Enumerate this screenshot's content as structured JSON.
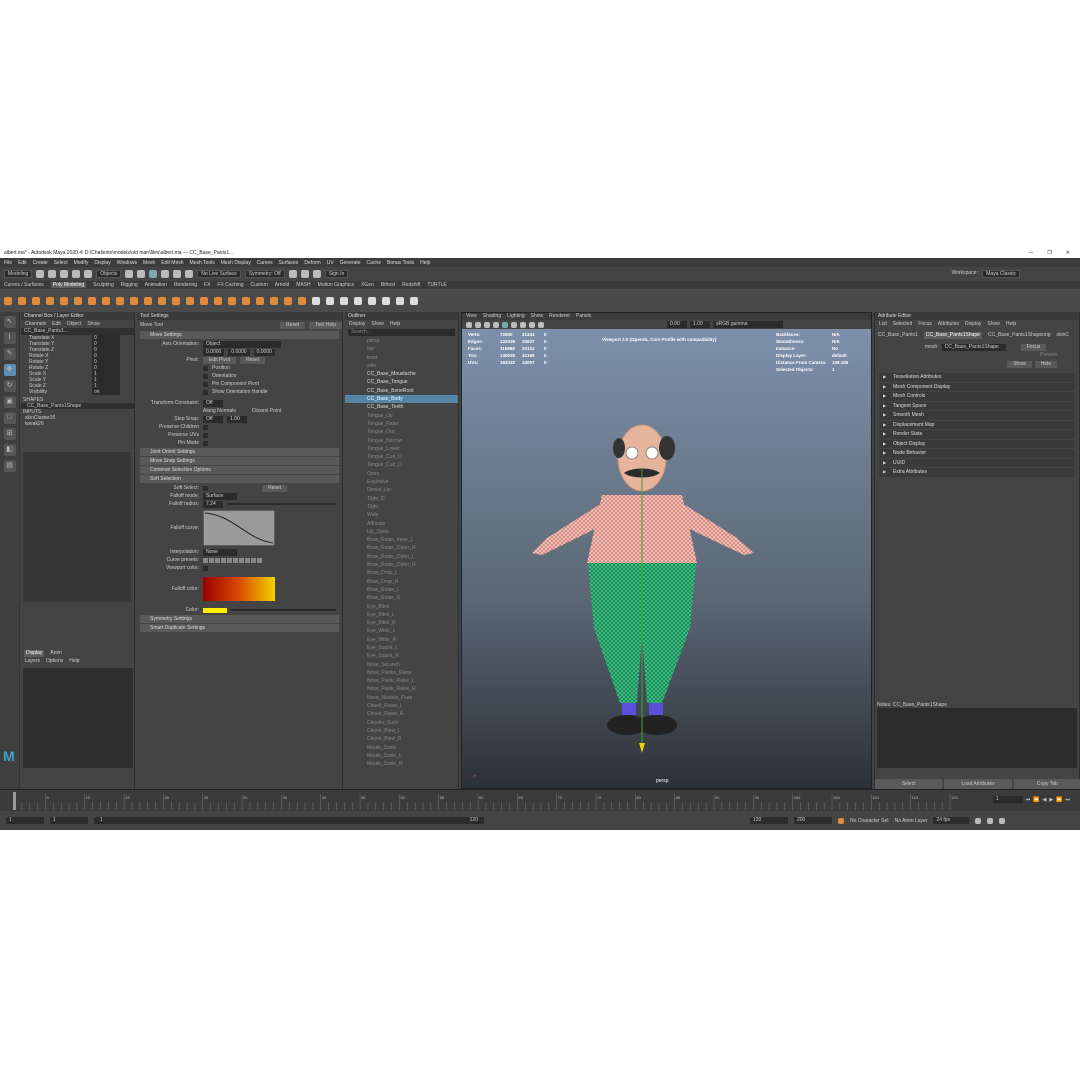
{
  "window": {
    "title": "albert.ma* - Autodesk Maya 2020.4: D:\\Challento\\models\\old man\\files\\albert.ma  ---  CC_Base_Pants1...",
    "controls": [
      "—",
      "❐",
      "✕"
    ]
  },
  "menus": [
    "File",
    "Edit",
    "Create",
    "Select",
    "Modify",
    "Display",
    "Windows",
    "Mesh",
    "Edit Mesh",
    "Mesh Tools",
    "Mesh Display",
    "Curves",
    "Surfaces",
    "Deform",
    "UV",
    "Generate",
    "Cache",
    "Bonus Tools",
    "Help"
  ],
  "workspace": {
    "label": "Workspace :",
    "value": "Maya Classic"
  },
  "status": {
    "mode": "Modeling",
    "objects": "Objects",
    "live": "No Live Surface",
    "symmetry": "Symmetry: Off",
    "signin": "Sign In"
  },
  "shelf_tabs": [
    "Curves / Surfaces",
    "Poly Modeling",
    "Sculpting",
    "Rigging",
    "Animation",
    "Rendering",
    "FX",
    "FX Caching",
    "Custom",
    "Arnold",
    "MASH",
    "Motion Graphics",
    "XGen",
    "Bifrost",
    "Redshift",
    "TURTLE"
  ],
  "shelf_active": 1,
  "channel_box": {
    "title": "Channel Box / Layer Editor",
    "menus": [
      "Channels",
      "Edit",
      "Object",
      "Show"
    ],
    "object": "CC_Base_Pants1...",
    "channels": [
      [
        "Translate X",
        "0"
      ],
      [
        "Translate Y",
        "0"
      ],
      [
        "Translate Z",
        "0"
      ],
      [
        "Rotate X",
        "0"
      ],
      [
        "Rotate Y",
        "0"
      ],
      [
        "Rotate Z",
        "0"
      ],
      [
        "Scale X",
        "1"
      ],
      [
        "Scale Y",
        "1"
      ],
      [
        "Scale Z",
        "1"
      ],
      [
        "Visibility",
        "on"
      ]
    ],
    "shapes_label": "SHAPES",
    "shape": "CC_Base_Pants1Shape",
    "inputs_label": "INPUTS",
    "inputs": [
      "skinCluster26",
      "tweak26"
    ],
    "layer_tabs": [
      "Display",
      "Anim"
    ],
    "layer_menus": [
      "Layers",
      "Options",
      "Help"
    ]
  },
  "tool_settings": {
    "title": "Tool Settings",
    "tool": "Move Tool",
    "reset": "Reset",
    "help": "Tool Help",
    "move_settings": "Move Settings",
    "axis_label": "Axis Orientation:",
    "axis_value": "Object",
    "coords": [
      "0.0000",
      "0.0000",
      "0.0000"
    ],
    "pivot_label": "Pivot:",
    "edit_pivot": "Edit Pivot",
    "pivot_opts": [
      "Position",
      "Orientation",
      "Pin Component Pivot",
      "Show Orientation Handle"
    ],
    "constraint_label": "Transform Constraint:",
    "constraint_value": "Off",
    "along_normals": "Along Normals",
    "closest_point": "Closest Point",
    "step_snap_label": "Step Snap:",
    "step_snap_value": "Off",
    "step_val": "1.00",
    "preserve": [
      "Preserve Children",
      "Preserve UVs",
      "Pin Mode"
    ],
    "joint_sec": "Joint Orient Settings",
    "snap_sec": "Move Snap Settings",
    "common_sec": "Common Selection Options",
    "soft_sec": "Soft Selection",
    "soft_select": "Soft Select:",
    "falloff_mode": "Falloff mode:",
    "falloff_mode_value": "Surface",
    "falloff_radius": "Falloff radius:",
    "falloff_radius_value": "7.24",
    "falloff_curve": "Falloff curve:",
    "interp_label": "Interpolation:",
    "interp_value": "None",
    "curve_presets": "Curve presets:",
    "viewport_color": "Viewport color:",
    "falloff_color": "Falloff color:",
    "color_label": "Color:",
    "sym_sec": "Symmetry Settings",
    "smart_sec": "Smart Duplicate Settings"
  },
  "outliner": {
    "title": "Outliner",
    "menus": [
      "Display",
      "Show",
      "Help"
    ],
    "search": "Search...",
    "items": [
      {
        "name": "persp",
        "vis": false
      },
      {
        "name": "top",
        "vis": false
      },
      {
        "name": "front",
        "vis": false
      },
      {
        "name": "side",
        "vis": false
      },
      {
        "name": "CC_Base_Moustache",
        "vis": true
      },
      {
        "name": "CC_Base_Tongue",
        "vis": true
      },
      {
        "name": "CC_Base_BoneRoot",
        "vis": true
      },
      {
        "name": "CC_Base_Body",
        "vis": true,
        "sel": true
      },
      {
        "name": "CC_Base_Teeth",
        "vis": true
      },
      {
        "name": "Tongue_Up",
        "vis": false
      },
      {
        "name": "Tongue_Raise",
        "vis": false
      },
      {
        "name": "Tongue_Out",
        "vis": false
      },
      {
        "name": "Tongue_Narrow",
        "vis": false
      },
      {
        "name": "Tongue_Lower",
        "vis": false
      },
      {
        "name": "Tongue_Curl_U",
        "vis": false
      },
      {
        "name": "Tongue_Curl_D",
        "vis": false
      },
      {
        "name": "Open",
        "vis": false
      },
      {
        "name": "Explosive",
        "vis": false
      },
      {
        "name": "Dental_Lip",
        "vis": false
      },
      {
        "name": "Tight_O",
        "vis": false
      },
      {
        "name": "Tight",
        "vis": false
      },
      {
        "name": "Wide",
        "vis": false
      },
      {
        "name": "Affricate",
        "vis": false
      },
      {
        "name": "Lip_Open",
        "vis": false
      },
      {
        "name": "Brow_Raise_Inner_L",
        "vis": false
      },
      {
        "name": "Brow_Raise_Outer_R",
        "vis": false
      },
      {
        "name": "Brow_Raise_Outer_L",
        "vis": false
      },
      {
        "name": "Brow_Raise_Outer_R",
        "vis": false
      },
      {
        "name": "Brow_Drop_L",
        "vis": false
      },
      {
        "name": "Brow_Drop_R",
        "vis": false
      },
      {
        "name": "Brow_Raise_L",
        "vis": false
      },
      {
        "name": "Brow_Raise_R",
        "vis": false
      },
      {
        "name": "Eye_Blink",
        "vis": false
      },
      {
        "name": "Eye_Blink_L",
        "vis": false
      },
      {
        "name": "Eye_Blink_R",
        "vis": false
      },
      {
        "name": "Eye_Wide_L",
        "vis": false
      },
      {
        "name": "Eye_Wide_R",
        "vis": false
      },
      {
        "name": "Eye_Squint_L",
        "vis": false
      },
      {
        "name": "Eye_Squint_R",
        "vis": false
      },
      {
        "name": "Nose_Scrunch",
        "vis": false
      },
      {
        "name": "Nose_Flanks_Raise",
        "vis": false
      },
      {
        "name": "Nose_Flank_Raise_L",
        "vis": false
      },
      {
        "name": "Nose_Flank_Raise_R",
        "vis": false
      },
      {
        "name": "Nose_Nostrils_Flare",
        "vis": false
      },
      {
        "name": "Cheek_Raise_L",
        "vis": false
      },
      {
        "name": "Cheek_Raise_R",
        "vis": false
      },
      {
        "name": "Cheeks_Suck",
        "vis": false
      },
      {
        "name": "Cheek_Blow_L",
        "vis": false
      },
      {
        "name": "Cheek_Blow_R",
        "vis": false
      },
      {
        "name": "Mouth_Smile",
        "vis": false
      },
      {
        "name": "Mouth_Smile_L",
        "vis": false
      },
      {
        "name": "Mouth_Smile_R",
        "vis": false
      }
    ]
  },
  "viewport": {
    "menus": [
      "View",
      "Shading",
      "Lighting",
      "Show",
      "Renderer",
      "Panels"
    ],
    "exposure": "0.00",
    "gamma": "1.00",
    "colorspace": "sRGB gamma",
    "hud_left": [
      [
        "Verts:",
        "72850",
        "21344",
        "0"
      ],
      [
        "Edges:",
        "132039",
        "40637",
        "0"
      ],
      [
        "Faces:",
        "115988",
        "20124",
        "0"
      ],
      [
        "Tris:",
        "140038",
        "42199",
        "0"
      ],
      [
        "UVs:",
        "184032",
        "34097",
        "0"
      ]
    ],
    "hud_right": [
      [
        "Backfaces:",
        "N/A"
      ],
      [
        "Smoothness:",
        "N/A"
      ],
      [
        "Instance:",
        "No"
      ],
      [
        "Display Layer:",
        "default"
      ],
      [
        "Distance From Camera:",
        "108.198"
      ],
      [
        "Selected Objects:",
        "1"
      ]
    ],
    "note": "Viewport 2.0 (OpenGL Core Profile with compatibility)",
    "camera": "persp"
  },
  "attr_editor": {
    "title": "Attribute Editor",
    "menus": [
      "List",
      "Selected",
      "Focus",
      "Attributes",
      "Display",
      "Show",
      "Help"
    ],
    "tabs": [
      "CC_Base_Pants1",
      "CC_Base_Pants1Shape",
      "CC_Base_Pants1Shapeorig",
      "skinC"
    ],
    "active_tab": 1,
    "mesh_label": "mesh:",
    "mesh_value": "CC_Base_Pants1Shape",
    "focus": "Focus",
    "presets": "Presets",
    "show": "Show",
    "hide": "Hide",
    "sections": [
      "Tessellation Attributes",
      "Mesh Component Display",
      "Mesh Controls",
      "Tangent Space",
      "Smooth Mesh",
      "Displacement Map",
      "Render Stats",
      "Object Display",
      "Node Behavior",
      "UUID",
      "Extra Attributes"
    ],
    "notes": "Notes:  CC_Base_Pants1Shape",
    "buttons": [
      "Select",
      "Load Attributes",
      "Copy Tab"
    ]
  },
  "timeline": {
    "ticks": [
      "5",
      "10",
      "15",
      "20",
      "25",
      "30",
      "35",
      "40",
      "45",
      "50",
      "55",
      "60",
      "65",
      "70",
      "75",
      "80",
      "85",
      "90",
      "95",
      "100",
      "105",
      "110",
      "115",
      "120"
    ],
    "current": "1"
  },
  "range": {
    "start": "1",
    "start2": "1",
    "mid": "1",
    "end_mark": "120",
    "end": "120",
    "end2": "200",
    "character": "No Character Set",
    "anim_layer": "No Anim Layer",
    "fps": "24 fps"
  }
}
